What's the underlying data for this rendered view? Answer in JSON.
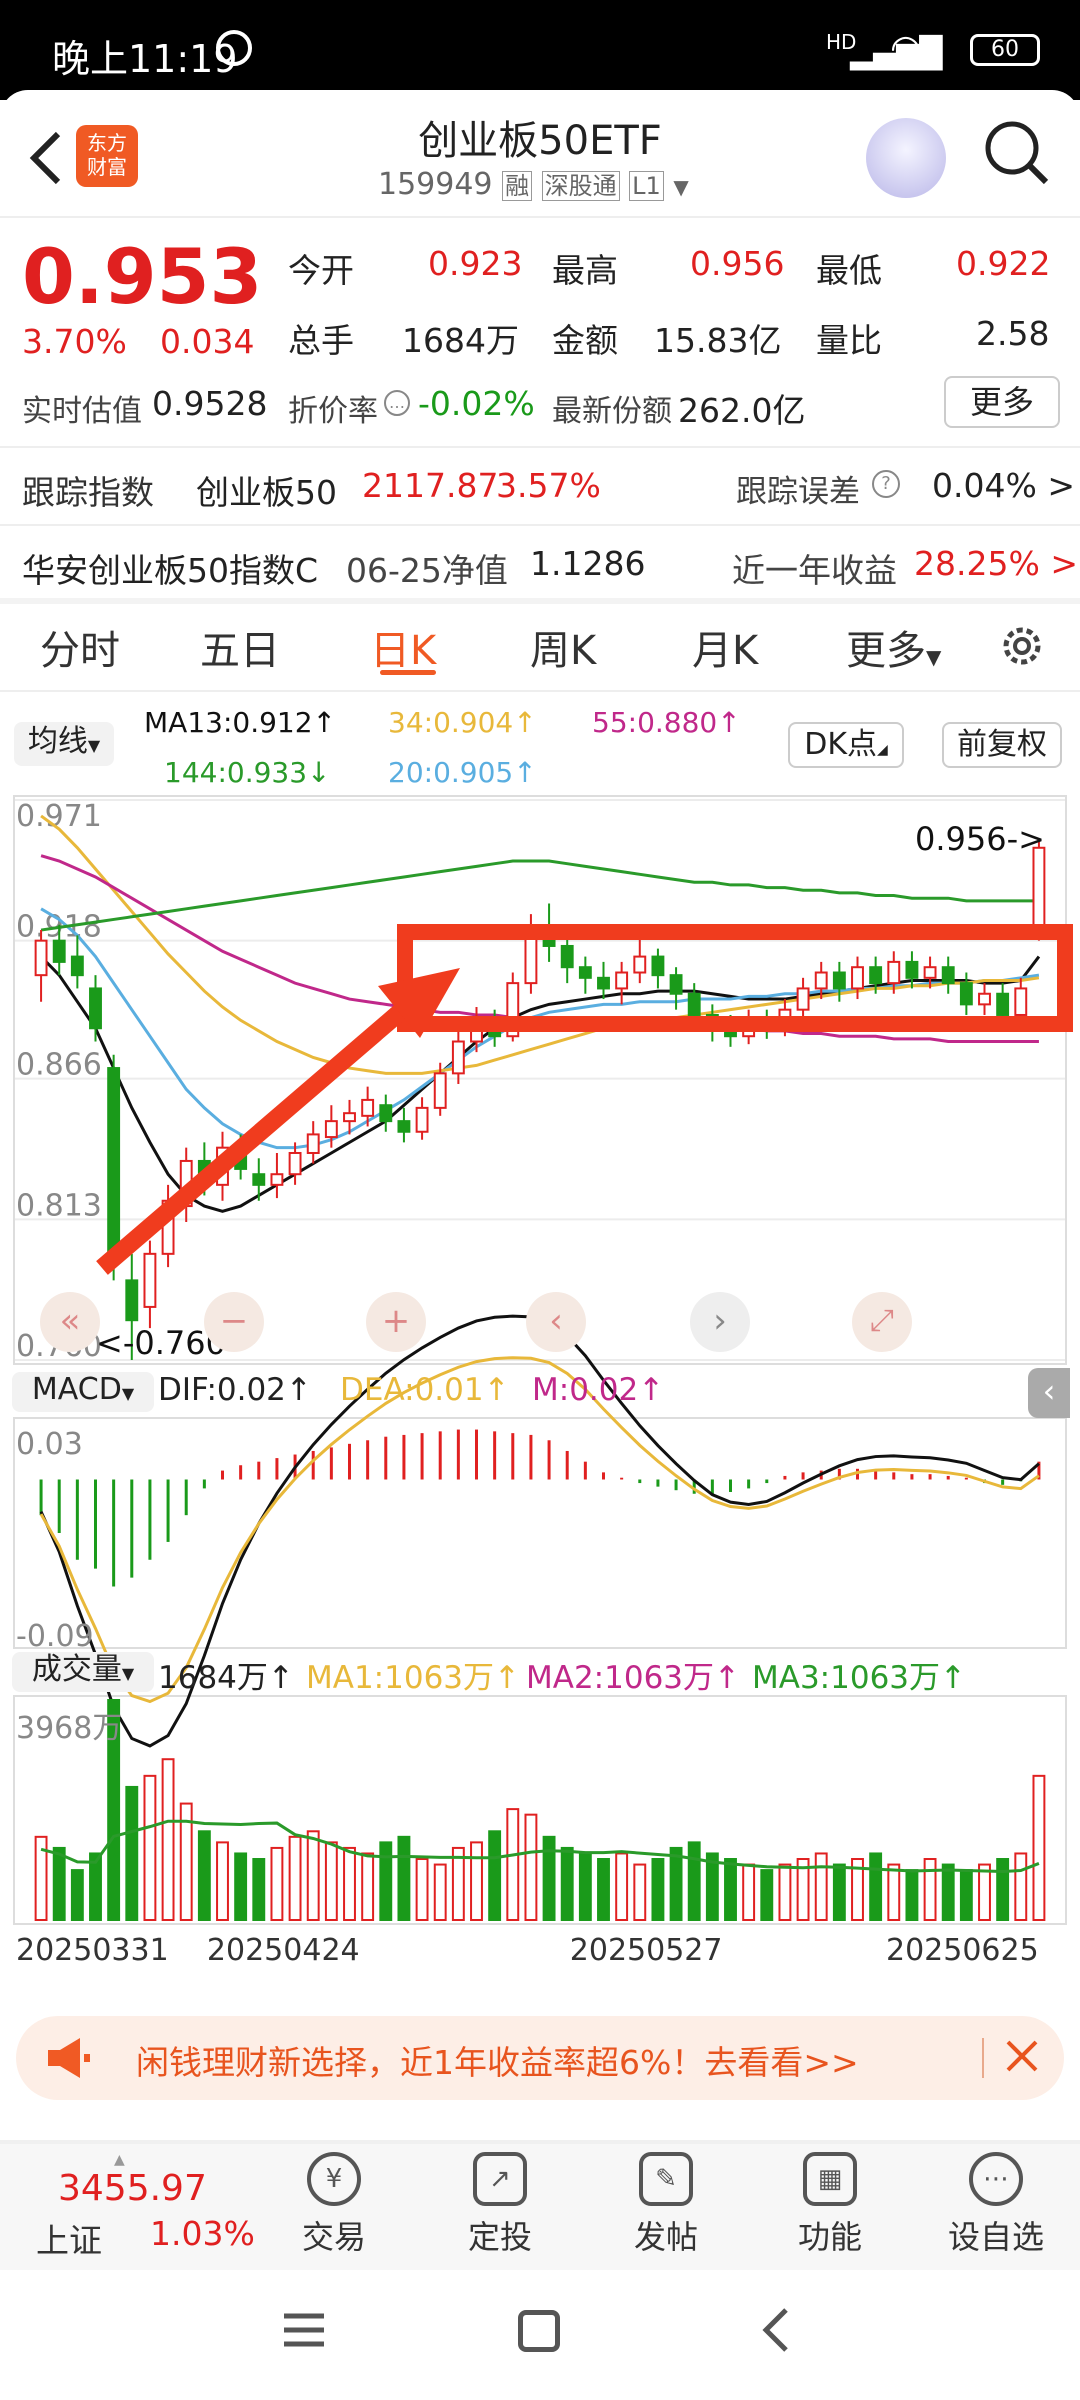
{
  "status_bar": {
    "time": "晚上11:19",
    "network": "HD",
    "battery": "60"
  },
  "header": {
    "brand_line1": "东方",
    "brand_line2": "财富",
    "title": "创业板50ETF",
    "code": "159949",
    "tag1": "融",
    "tag2": "深股通",
    "tag3": "L1"
  },
  "quote": {
    "price": "0.953",
    "change_pct": "3.70%",
    "change_abs": "0.034",
    "open_label": "今开",
    "open": "0.923",
    "high_label": "最高",
    "high": "0.956",
    "low_label": "最低",
    "low": "0.922",
    "volume_label": "总手",
    "volume": "1684万",
    "amount_label": "金额",
    "amount": "15.83亿",
    "ratio_label": "量比",
    "ratio": "2.58",
    "est_label": "实时估值",
    "est": "0.9528",
    "premium_label": "折价率",
    "premium": "-0.02%",
    "shares_label": "最新份额",
    "shares": "262.0亿",
    "more_label": "更多"
  },
  "tracking": {
    "label": "跟踪指数",
    "index_name": "创业板50",
    "index_value": "2117.87",
    "index_pct": "3.57%",
    "error_label": "跟踪误差",
    "error": "0.04% >",
    "fund_name": "华安创业板50指数C",
    "nav_label": "06-25净值",
    "nav": "1.1286",
    "return_label": "近一年收益",
    "return": "28.25% >"
  },
  "tabs": [
    "分时",
    "五日",
    "日K",
    "周K",
    "月K",
    "更多"
  ],
  "chart_header": {
    "ma_dropdown": "均线",
    "ma13": "MA13:0.912↑",
    "ma34": "34:0.904↑",
    "ma55": "55:0.880↑",
    "ma144": "144:0.933↓",
    "ma20": "20:0.905↑",
    "dk_button": "DK点",
    "adjust_button": "前复权"
  },
  "macd_header": {
    "dropdown": "MACD",
    "dif": "DIF:0.02↑",
    "dea": "DEA:0.01↑",
    "m": "M:0.02↑"
  },
  "vol_header": {
    "dropdown": "成交量",
    "vol": "1684万↑",
    "ma1": "MA1:1063万↑",
    "ma2": "MA2:1063万↑",
    "ma3": "MA3:1063万↑"
  },
  "chart_data": {
    "type": "candlestick",
    "y_ticks": [
      "0.971",
      "0.918",
      "0.866",
      "0.813",
      "0.760"
    ],
    "ylim": [
      0.76,
      0.971
    ],
    "high_label": "0.956->",
    "low_label": "<-0.760",
    "macd_ticks": [
      "0.03",
      "-0.09"
    ],
    "vol_tick": "3968万",
    "dates": [
      "20250331",
      "20250424",
      "20250527",
      "20250625"
    ],
    "candles": [
      [
        0.905,
        0.918,
        0.922,
        0.895
      ],
      [
        0.918,
        0.91,
        0.924,
        0.905
      ],
      [
        0.912,
        0.905,
        0.92,
        0.9
      ],
      [
        0.9,
        0.885,
        0.905,
        0.88
      ],
      [
        0.87,
        0.8,
        0.875,
        0.79
      ],
      [
        0.79,
        0.775,
        0.8,
        0.76
      ],
      [
        0.78,
        0.8,
        0.805,
        0.772
      ],
      [
        0.8,
        0.82,
        0.826,
        0.795
      ],
      [
        0.818,
        0.835,
        0.84,
        0.812
      ],
      [
        0.835,
        0.828,
        0.842,
        0.822
      ],
      [
        0.826,
        0.84,
        0.846,
        0.82
      ],
      [
        0.838,
        0.832,
        0.845,
        0.828
      ],
      [
        0.83,
        0.826,
        0.836,
        0.82
      ],
      [
        0.826,
        0.83,
        0.838,
        0.821
      ],
      [
        0.83,
        0.838,
        0.842,
        0.826
      ],
      [
        0.838,
        0.845,
        0.85,
        0.834
      ],
      [
        0.844,
        0.85,
        0.856,
        0.84
      ],
      [
        0.85,
        0.853,
        0.858,
        0.845
      ],
      [
        0.852,
        0.858,
        0.863,
        0.848
      ],
      [
        0.856,
        0.85,
        0.86,
        0.846
      ],
      [
        0.85,
        0.846,
        0.855,
        0.842
      ],
      [
        0.846,
        0.855,
        0.859,
        0.843
      ],
      [
        0.855,
        0.868,
        0.872,
        0.852
      ],
      [
        0.868,
        0.88,
        0.885,
        0.864
      ],
      [
        0.88,
        0.888,
        0.893,
        0.876
      ],
      [
        0.888,
        0.882,
        0.892,
        0.878
      ],
      [
        0.882,
        0.902,
        0.906,
        0.88
      ],
      [
        0.902,
        0.922,
        0.928,
        0.898
      ],
      [
        0.92,
        0.916,
        0.932,
        0.91
      ],
      [
        0.916,
        0.908,
        0.92,
        0.902
      ],
      [
        0.908,
        0.904,
        0.912,
        0.898
      ],
      [
        0.904,
        0.9,
        0.91,
        0.896
      ],
      [
        0.9,
        0.906,
        0.91,
        0.894
      ],
      [
        0.906,
        0.912,
        0.92,
        0.902
      ],
      [
        0.912,
        0.905,
        0.915,
        0.9
      ],
      [
        0.905,
        0.898,
        0.908,
        0.892
      ],
      [
        0.898,
        0.89,
        0.902,
        0.885
      ],
      [
        0.89,
        0.885,
        0.894,
        0.88
      ],
      [
        0.885,
        0.882,
        0.89,
        0.878
      ],
      [
        0.882,
        0.888,
        0.892,
        0.879
      ],
      [
        0.888,
        0.886,
        0.892,
        0.881
      ],
      [
        0.886,
        0.892,
        0.896,
        0.882
      ],
      [
        0.892,
        0.9,
        0.904,
        0.888
      ],
      [
        0.9,
        0.906,
        0.91,
        0.896
      ],
      [
        0.906,
        0.9,
        0.91,
        0.895
      ],
      [
        0.9,
        0.908,
        0.912,
        0.896
      ],
      [
        0.908,
        0.902,
        0.912,
        0.898
      ],
      [
        0.902,
        0.91,
        0.914,
        0.898
      ],
      [
        0.91,
        0.904,
        0.914,
        0.9
      ],
      [
        0.904,
        0.908,
        0.912,
        0.9
      ],
      [
        0.908,
        0.902,
        0.912,
        0.898
      ],
      [
        0.902,
        0.894,
        0.906,
        0.89
      ],
      [
        0.894,
        0.898,
        0.902,
        0.89
      ],
      [
        0.898,
        0.89,
        0.902,
        0.886
      ],
      [
        0.89,
        0.9,
        0.904,
        0.887
      ],
      [
        0.919,
        0.953,
        0.956,
        0.918
      ]
    ],
    "macd_bars": [
      -0.02,
      -0.03,
      -0.045,
      -0.05,
      -0.06,
      -0.055,
      -0.045,
      -0.035,
      -0.02,
      -0.005,
      0.005,
      0.008,
      0.01,
      0.012,
      0.014,
      0.016,
      0.018,
      0.02,
      0.022,
      0.024,
      0.025,
      0.026,
      0.027,
      0.028,
      0.028,
      0.027,
      0.026,
      0.025,
      0.022,
      0.016,
      0.01,
      0.004,
      0.001,
      -0.002,
      -0.004,
      -0.006,
      -0.008,
      -0.009,
      -0.007,
      -0.005,
      -0.002,
      0.002,
      0.004,
      0.005,
      0.006,
      0.006,
      0.005,
      0.004,
      0.003,
      0.003,
      0.002,
      0.001,
      -0.002,
      -0.003,
      -0.001,
      0.01
    ],
    "volume": [
      1500,
      1300,
      900,
      1200,
      3968,
      2400,
      2600,
      2900,
      2100,
      1600,
      1400,
      1200,
      1100,
      1300,
      1500,
      1600,
      1400,
      1300,
      1200,
      1400,
      1500,
      1100,
      1000,
      1300,
      1400,
      1600,
      2000,
      1900,
      1500,
      1300,
      1200,
      1100,
      1200,
      1000,
      1100,
      1300,
      1400,
      1200,
      1100,
      1000,
      900,
      1000,
      1100,
      1200,
      1000,
      1100,
      1200,
      1000,
      900,
      1100,
      1000,
      900,
      1000,
      1100,
      1200,
      2600
    ],
    "ma_lines": {
      "ma13": [
        0.912,
        0.905,
        0.895,
        0.885,
        0.87,
        0.855,
        0.842,
        0.83,
        0.822,
        0.818,
        0.816,
        0.818,
        0.822,
        0.826,
        0.83,
        0.834,
        0.838,
        0.842,
        0.846,
        0.85,
        0.856,
        0.862,
        0.868,
        0.874,
        0.88,
        0.885,
        0.889,
        0.892,
        0.894,
        0.895,
        0.896,
        0.897,
        0.898,
        0.898,
        0.899,
        0.899,
        0.899,
        0.898,
        0.897,
        0.896,
        0.896,
        0.896,
        0.897,
        0.898,
        0.899,
        0.9,
        0.901,
        0.902,
        0.903,
        0.903,
        0.903,
        0.903,
        0.902,
        0.902,
        0.903,
        0.912
      ],
      "ma20": [
        0.93,
        0.926,
        0.92,
        0.912,
        0.902,
        0.892,
        0.882,
        0.872,
        0.862,
        0.855,
        0.849,
        0.845,
        0.842,
        0.84,
        0.84,
        0.841,
        0.843,
        0.846,
        0.85,
        0.854,
        0.858,
        0.863,
        0.868,
        0.873,
        0.878,
        0.882,
        0.886,
        0.889,
        0.891,
        0.892,
        0.893,
        0.894,
        0.894,
        0.895,
        0.895,
        0.895,
        0.896,
        0.896,
        0.896,
        0.897,
        0.897,
        0.898,
        0.898,
        0.899,
        0.899,
        0.9,
        0.9,
        0.901,
        0.901,
        0.902,
        0.902,
        0.902,
        0.903,
        0.903,
        0.904,
        0.905
      ],
      "ma34": [
        0.965,
        0.96,
        0.953,
        0.945,
        0.937,
        0.929,
        0.921,
        0.913,
        0.906,
        0.899,
        0.893,
        0.888,
        0.884,
        0.88,
        0.877,
        0.874,
        0.872,
        0.87,
        0.869,
        0.868,
        0.868,
        0.868,
        0.869,
        0.87,
        0.871,
        0.873,
        0.875,
        0.877,
        0.879,
        0.881,
        0.883,
        0.885,
        0.886,
        0.887,
        0.888,
        0.889,
        0.89,
        0.891,
        0.892,
        0.893,
        0.894,
        0.895,
        0.896,
        0.897,
        0.898,
        0.899,
        0.9,
        0.9,
        0.901,
        0.901,
        0.902,
        0.902,
        0.903,
        0.903,
        0.903,
        0.904
      ],
      "ma55": [
        0.95,
        0.948,
        0.945,
        0.942,
        0.938,
        0.934,
        0.93,
        0.926,
        0.922,
        0.918,
        0.914,
        0.911,
        0.908,
        0.905,
        0.902,
        0.9,
        0.898,
        0.896,
        0.895,
        0.894,
        0.893,
        0.892,
        0.891,
        0.891,
        0.89,
        0.89,
        0.889,
        0.889,
        0.889,
        0.888,
        0.888,
        0.888,
        0.887,
        0.887,
        0.887,
        0.886,
        0.886,
        0.886,
        0.885,
        0.885,
        0.884,
        0.884,
        0.883,
        0.883,
        0.882,
        0.882,
        0.882,
        0.881,
        0.881,
        0.881,
        0.88,
        0.88,
        0.88,
        0.88,
        0.88,
        0.88
      ],
      "ma144": [
        0.922,
        0.923,
        0.924,
        0.925,
        0.926,
        0.927,
        0.928,
        0.929,
        0.93,
        0.931,
        0.932,
        0.933,
        0.934,
        0.935,
        0.936,
        0.937,
        0.938,
        0.939,
        0.94,
        0.941,
        0.942,
        0.943,
        0.944,
        0.945,
        0.946,
        0.947,
        0.948,
        0.948,
        0.948,
        0.947,
        0.946,
        0.945,
        0.944,
        0.943,
        0.942,
        0.941,
        0.94,
        0.94,
        0.939,
        0.939,
        0.938,
        0.938,
        0.937,
        0.937,
        0.936,
        0.936,
        0.935,
        0.935,
        0.934,
        0.934,
        0.934,
        0.933,
        0.933,
        0.933,
        0.933,
        0.933
      ]
    }
  },
  "ad_banner": {
    "text": "闲钱理财新选择，近1年收益率超6%！去看看>>"
  },
  "bottom_nav": {
    "index_value": "3455.97",
    "index_name": "上证",
    "index_pct": "1.03%",
    "items": [
      "交易",
      "定投",
      "发帖",
      "功能",
      "设自选"
    ]
  },
  "colors": {
    "up": "#e02020",
    "down": "#1a9a1a",
    "ma13": "#111111",
    "ma20": "#5aaee0",
    "ma34": "#e8b83a",
    "ma55": "#c0288a",
    "ma144": "#2a9a2a",
    "annotation": "#f03c1e"
  },
  "icons": [
    "back-arrow-icon",
    "search-icon",
    "settings-gear-icon",
    "megaphone-icon",
    "close-icon"
  ]
}
